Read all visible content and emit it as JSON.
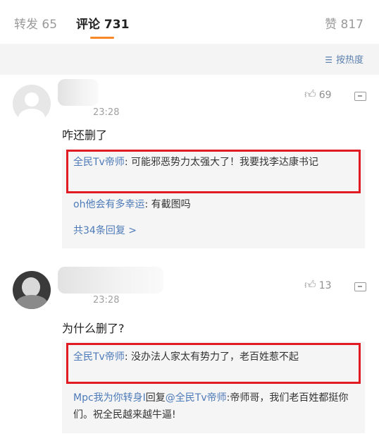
{
  "tabs": {
    "repost": "转发 65",
    "comment": "评论 731",
    "like": "赞 817"
  },
  "sort": {
    "icon": "sort-icon",
    "label": "按热度"
  },
  "comments": [
    {
      "time": "23:28",
      "likes": "69",
      "text": "咋还删了",
      "replies": [
        {
          "user": "全民Tv帝师",
          "text": ": 可能邪恶势力太强大了！我要找李达康书记"
        },
        {
          "user": "oh他会有多幸运",
          "text": ": 有截图吗"
        }
      ],
      "more": "共34条回复 >"
    },
    {
      "time": "23:28",
      "likes": "13",
      "text": "为什么删了?",
      "replies": [
        {
          "user": "全民Tv帝师",
          "text": ": 没办法人家太有势力了，老百姓惹不起"
        },
        {
          "user": "Mpc我为你转身I",
          "text": "回复",
          "mention": "@全民Tv帝师",
          "text2": ":帝师哥，我们老百姓都挺你们。祝全民越来越牛逼!"
        }
      ]
    }
  ],
  "colors": {
    "accent": "#f78826",
    "link": "#4d7ab8",
    "highlight": "#e01b24"
  }
}
